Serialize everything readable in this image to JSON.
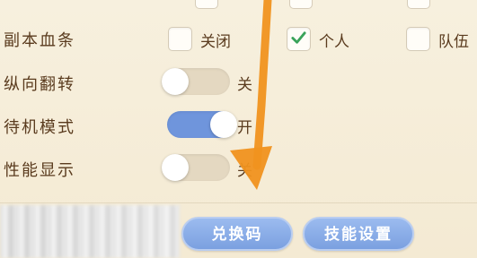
{
  "settings": {
    "rows": [
      {
        "label": "副本血条",
        "type": "checkbox-group",
        "options": [
          {
            "label": "关闭",
            "checked": false
          },
          {
            "label": "个人",
            "checked": true
          },
          {
            "label": "队伍",
            "checked": false
          }
        ]
      },
      {
        "label": "纵向翻转",
        "type": "toggle",
        "on": false,
        "state_label": "关"
      },
      {
        "label": "待机模式",
        "type": "toggle",
        "on": true,
        "state_label": "开"
      },
      {
        "label": "性能显示",
        "type": "toggle",
        "on": false,
        "state_label": "关"
      }
    ]
  },
  "footer": {
    "redeem_button": "兑换码",
    "skill_button": "技能设置"
  },
  "overlay": {
    "arrow_color": "#f0921f"
  },
  "colors": {
    "background": "#f7efdc",
    "text": "#5a3b1e",
    "toggle_on": "#6f95dc",
    "toggle_off": "#e4d8c1",
    "button": "#7ba0e0",
    "check": "#3aa35a"
  }
}
